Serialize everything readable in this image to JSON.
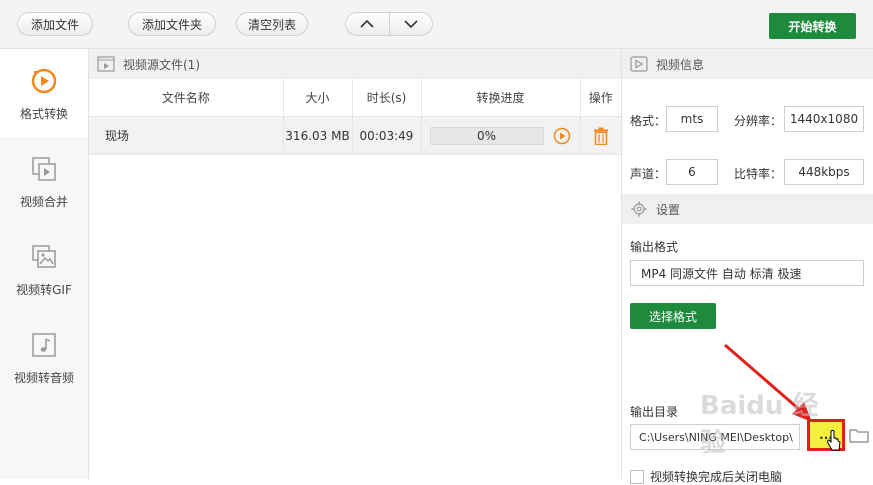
{
  "toolbar": {
    "add_file": "添加文件",
    "add_folder": "添加文件夹",
    "clear_list": "清空列表",
    "start_convert": "开始转换"
  },
  "sidebar": {
    "items": [
      {
        "label": "格式转换",
        "active": true
      },
      {
        "label": "视频合并",
        "active": false
      },
      {
        "label": "视频转GIF",
        "active": false
      },
      {
        "label": "视频转音频",
        "active": false
      }
    ]
  },
  "files": {
    "header_title": "视频源文件(1)",
    "columns": [
      "文件名称",
      "大小",
      "时长(s)",
      "转换进度",
      "操作"
    ],
    "rows": [
      {
        "name": "现场",
        "size": "316.03 MB",
        "duration": "00:03:49",
        "progress_text": "0%",
        "progress": 0
      }
    ]
  },
  "video_info": {
    "header_title": "视频信息",
    "format_label": "格式：",
    "format_value": "mts",
    "resolution_label": "分辨率：",
    "resolution_value": "1440x1080",
    "channel_label": "声道：",
    "channel_value": "6",
    "bitrate_label": "比特率：",
    "bitrate_value": "448kbps"
  },
  "settings": {
    "header_title": "设置",
    "output_format_label": "输出格式",
    "output_format_value": "MP4 同源文件 自动 标清 极速",
    "select_format_button": "选择格式",
    "output_dir_label": "输出目录",
    "output_dir_value": "C:\\Users\\NING MEI\\Desktop\\",
    "browse_button": "...",
    "shutdown_label": "视频转换完成后关闭电脑"
  },
  "colors": {
    "accent_green": "#1e8a3b",
    "active_icon_orange": "#f08a1d",
    "annotation_red": "#e0201b"
  },
  "watermark": "Baidu 经验"
}
